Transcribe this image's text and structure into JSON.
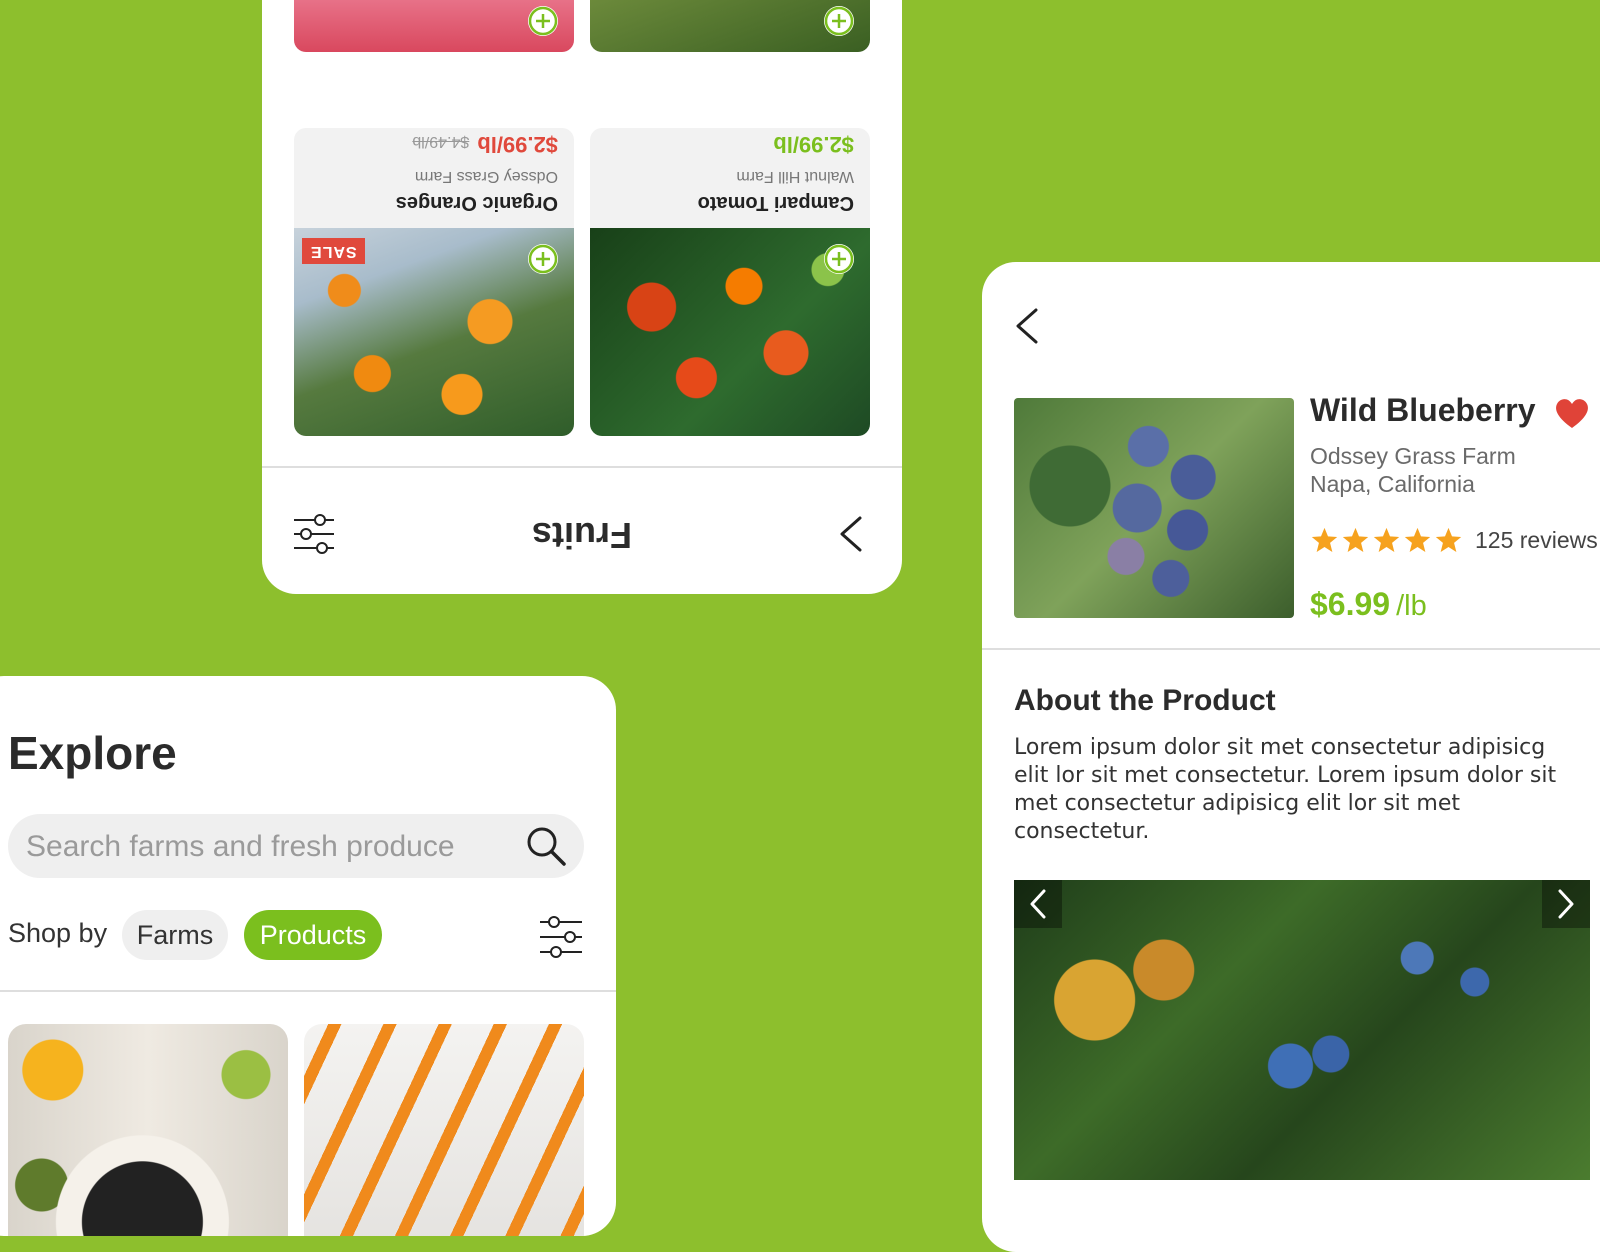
{
  "fruits_card": {
    "title": "Fruits",
    "products": [
      {
        "name": "Campari Tomato",
        "farm": "Walnut Hill Farm",
        "price": "$2.99/lb"
      },
      {
        "name": "Organic Oranges",
        "farm": "Odssey Grass Farm",
        "price": "$2.99/lb",
        "old_price": "$4.49/lb",
        "badge": "SALE"
      }
    ]
  },
  "explore": {
    "title": "Explore",
    "search_placeholder": "Search farms and fresh produce",
    "shop_by_label": "Shop by",
    "filters": [
      {
        "label": "Farms",
        "active": false
      },
      {
        "label": "Products",
        "active": true
      }
    ]
  },
  "detail": {
    "name": "Wild Blueberry",
    "farm": "Odssey Grass Farm",
    "location": "Napa, California",
    "rating": 5,
    "reviews": "125 reviews",
    "price": "$6.99",
    "unit": "/lb",
    "about_title": "About the Product",
    "about_text": "Lorem ipsum dolor sit met consectetur adipisicg elit lor sit met consectetur. Lorem ipsum dolor sit met consectetur adipisicg elit lor sit met consectetur."
  },
  "colors": {
    "background": "#8dbf2d",
    "accent_green": "#7bbf1e",
    "sale_red": "#e0493c",
    "heart_red": "#e04338",
    "star_orange": "#f6a21e"
  },
  "icons": [
    "chevron-right-icon",
    "filter-sliders-icon",
    "plus-circle-icon",
    "search-icon",
    "chevron-left-icon",
    "heart-icon",
    "star-icon"
  ]
}
